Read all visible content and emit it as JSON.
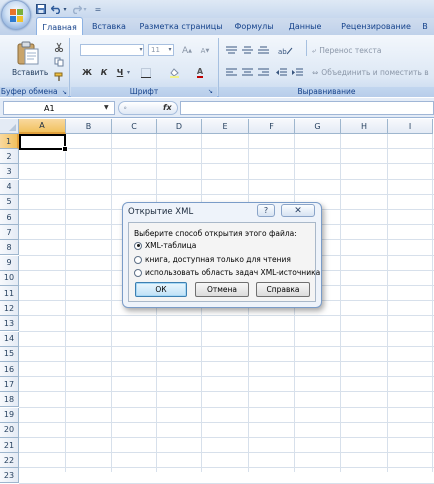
{
  "quick_access": {
    "dropdown_glyph": "="
  },
  "tabs": [
    {
      "label": "Главная",
      "active": true
    },
    {
      "label": "Вставка"
    },
    {
      "label": "Разметка страницы"
    },
    {
      "label": "Формулы"
    },
    {
      "label": "Данные"
    },
    {
      "label": "Рецензирование"
    },
    {
      "label": "В"
    }
  ],
  "ribbon": {
    "clipboard": {
      "paste_label": "Вставить",
      "group_label": "Буфер обмена"
    },
    "font": {
      "font_size": "11",
      "grow_glyph": "A",
      "shrink_glyph": "A",
      "bold": "Ж",
      "italic": "К",
      "underline": "Ч",
      "font_color_glyph": "A",
      "group_label": "Шрифт"
    },
    "alignment": {
      "wrap_text": "Перенос текста",
      "merge_center": "Объединить и поместить в",
      "group_label": "Выравнивание"
    }
  },
  "formula_bar": {
    "name_box": "A1",
    "fx_label": "fx"
  },
  "grid": {
    "columns": [
      "A",
      "B",
      "C",
      "D",
      "E",
      "F",
      "G",
      "H",
      "I"
    ],
    "rows": [
      "1",
      "2",
      "3",
      "4",
      "5",
      "6",
      "7",
      "8",
      "9",
      "10",
      "11",
      "12",
      "13",
      "14",
      "15",
      "16",
      "17",
      "18",
      "19",
      "20",
      "21",
      "22",
      "23"
    ],
    "active_cell": "A1"
  },
  "dialog": {
    "title": "Открытие XML",
    "help_glyph": "?",
    "close_glyph": "✕",
    "prompt": "Выберите способ открытия этого файла:",
    "options": [
      {
        "label": "XML-таблица",
        "selected": true
      },
      {
        "label": "книга, доступная только для чтения",
        "selected": false
      },
      {
        "label": "использовать область задач XML-источника",
        "selected": false
      }
    ],
    "buttons": {
      "ok": "ОК",
      "cancel": "Отмена",
      "help": "Справка"
    }
  },
  "colors": {
    "ribbon_bg": "#dde8f5",
    "selected_header": "#f1c15f",
    "dialog_bg": "#eef3fa",
    "accent_text": "#15428b"
  }
}
